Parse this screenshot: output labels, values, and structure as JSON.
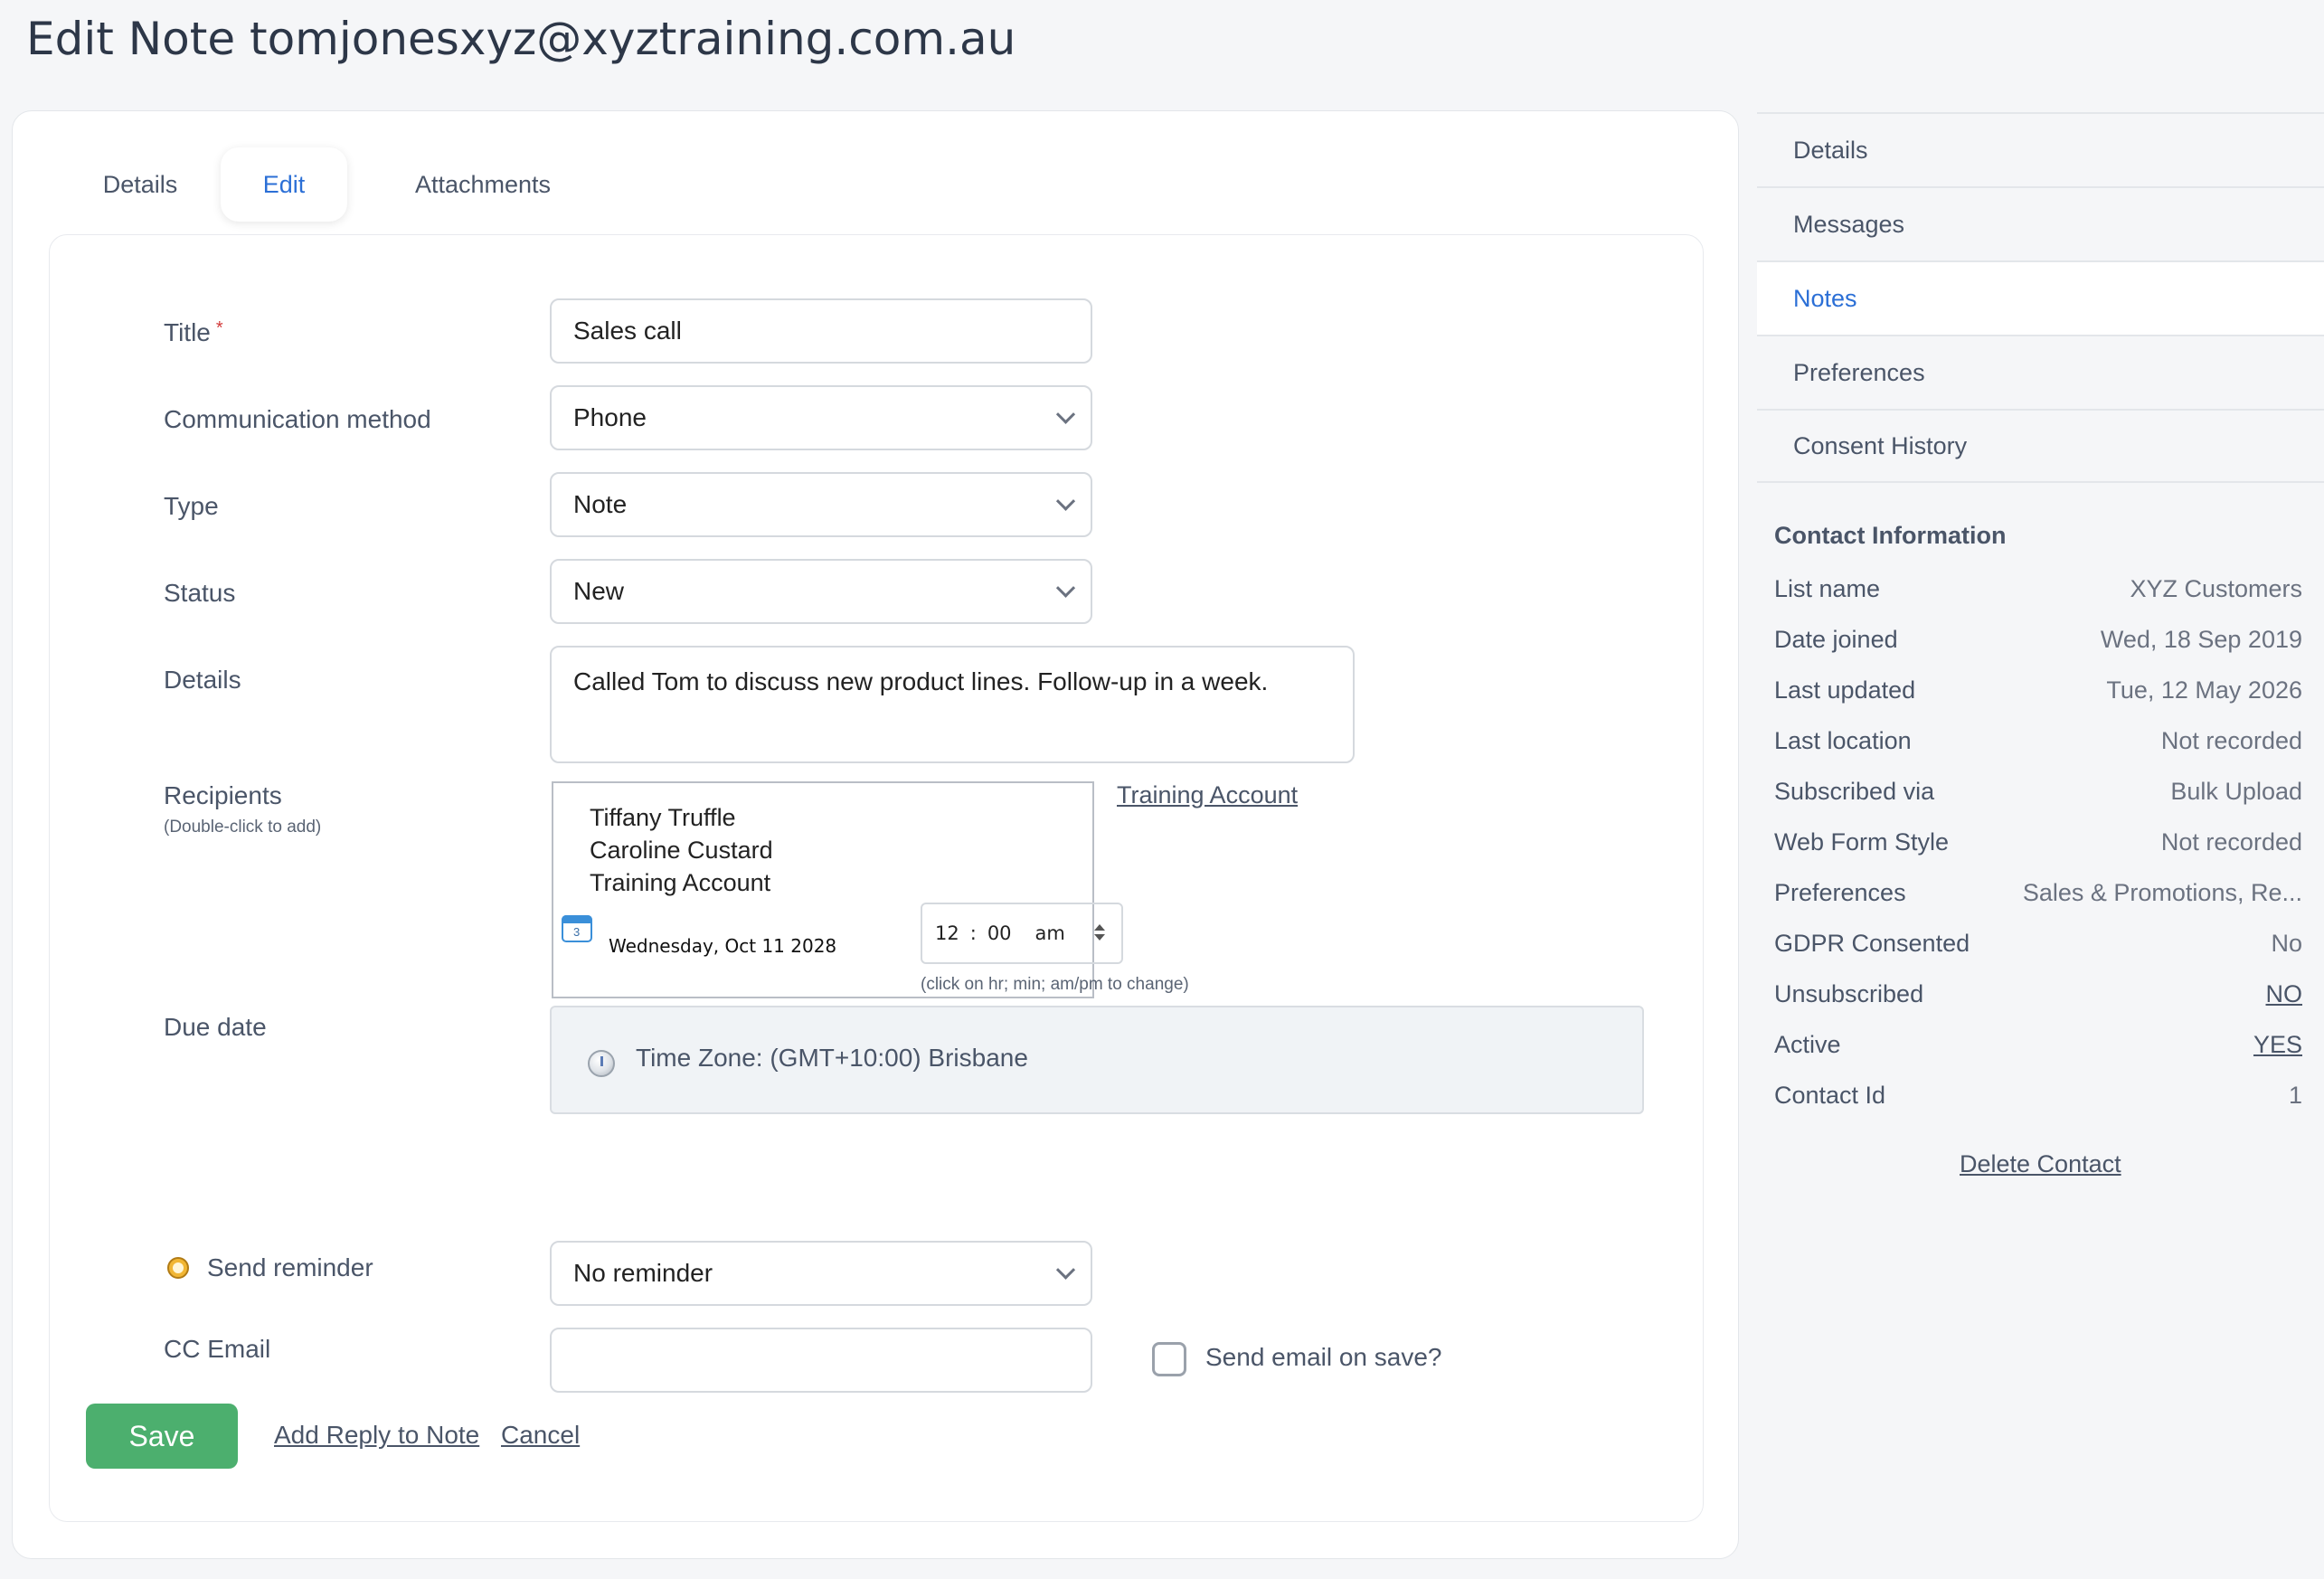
{
  "header": {
    "title": "Edit Note tomjonesxyz@xyztraining.com.au"
  },
  "tabs": [
    {
      "label": "Details"
    },
    {
      "label": "Edit"
    },
    {
      "label": "Attachments"
    }
  ],
  "form": {
    "title_label": "Title",
    "required_mark": "*",
    "title_value": "Sales call",
    "comm_label": "Communication method",
    "comm_value": "Phone",
    "type_label": "Type",
    "type_value": "Note",
    "status_label": "Status",
    "status_value": "New",
    "details_label": "Details",
    "details_value": "Called Tom to discuss new product lines. Follow-up in a week.",
    "recipients_label": "Recipients",
    "recipients_hint": "(Double-click to add)",
    "recipients": [
      "Tiffany Truffle",
      "Caroline Custard",
      "Training Account"
    ],
    "recipients_link": "Training Account",
    "due_label": "Due date",
    "calendar_day": "3",
    "due_date": "Wednesday, Oct 11 2028",
    "time_hour": "12",
    "time_sep": ":",
    "time_min": "00",
    "time_ampm": "am",
    "time_hint": "(click on hr; min; am/pm to change)",
    "timezone": "Time Zone: (GMT+10:00) Brisbane",
    "reminder_label": "Send reminder",
    "reminder_value": "No reminder",
    "cc_label": "CC Email",
    "cc_value": "",
    "send_email_label": "Send email on save?",
    "save_label": "Save",
    "add_reply_label": "Add Reply to Note",
    "cancel_label": "Cancel"
  },
  "sidebar": {
    "nav": [
      {
        "label": "Details"
      },
      {
        "label": "Messages"
      },
      {
        "label": "Notes"
      },
      {
        "label": "Preferences"
      },
      {
        "label": "Consent History"
      }
    ],
    "contact_info_title": "Contact Information",
    "contact_info": [
      {
        "key": "List name",
        "value": "XYZ Customers"
      },
      {
        "key": "Date joined",
        "value": "Wed, 18 Sep 2019"
      },
      {
        "key": "Last updated",
        "value": "Tue, 12 May 2026"
      },
      {
        "key": "Last location",
        "value": "Not recorded"
      },
      {
        "key": "Subscribed via",
        "value": "Bulk Upload"
      },
      {
        "key": "Web Form Style",
        "value": "Not recorded"
      },
      {
        "key": "Preferences",
        "value": "Sales & Promotions, Re..."
      },
      {
        "key": "GDPR Consented",
        "value": "No"
      },
      {
        "key": "Unsubscribed",
        "value": "NO"
      },
      {
        "key": "Active",
        "value": "YES"
      },
      {
        "key": "Contact Id",
        "value": "1"
      }
    ],
    "delete_label": "Delete Contact"
  },
  "colors": {
    "accent": "#2b6fd6",
    "save_green": "#4caf6e",
    "text": "#4a5568"
  }
}
